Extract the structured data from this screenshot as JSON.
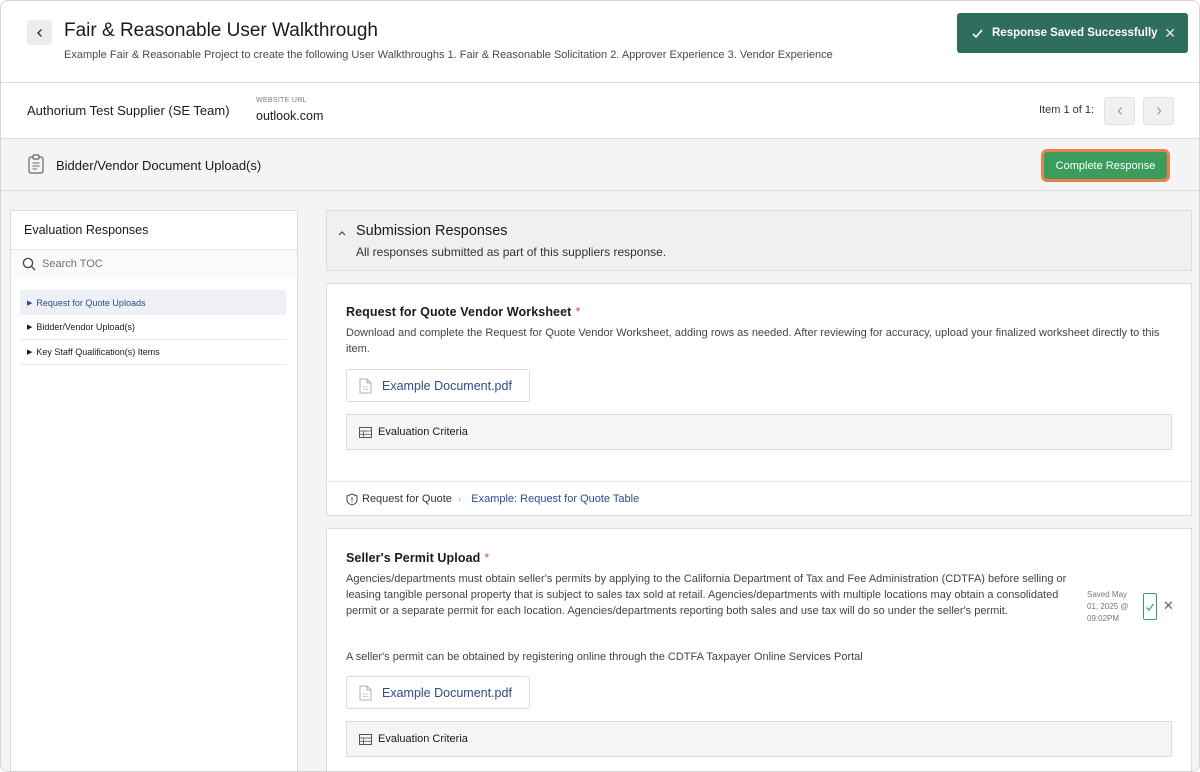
{
  "header": {
    "title": "Fair & Reasonable User Walkthrough",
    "subtitle": "Example Fair & Reasonable Project to create the following User Walkthroughs 1. Fair & Reasonable Solicitation 2. Approver Experience 3. Vendor Experience"
  },
  "toast": {
    "message": "Response Saved Successfully",
    "close_icon": "close-icon"
  },
  "supplier": {
    "name": "Authorium Test Supplier (SE Team)",
    "website_label": "WEBSITE URL",
    "website": "outlook.com",
    "item_count": "Item 1 of 1:"
  },
  "section": {
    "title": "Bidder/Vendor Document Upload(s)",
    "complete_label": "Complete Response"
  },
  "toc": {
    "title": "Evaluation Responses",
    "search_placeholder": "Search TOC",
    "items": [
      {
        "label": "Request for Quote Uploads",
        "active": true
      },
      {
        "label": "Bidder/Vendor Upload(s)",
        "active": false
      },
      {
        "label": "Key Staff Qualification(s) Items",
        "active": false
      }
    ]
  },
  "submission": {
    "title": "Submission Responses",
    "description": "All responses submitted as part of this suppliers response."
  },
  "cards": [
    {
      "title": "Request for Quote Vendor Worksheet",
      "required": "*",
      "description": "Download and complete the Request for Quote Vendor Worksheet, adding rows as needed. After reviewing for accuracy, upload your finalized worksheet directly to this item.",
      "document": "Example Document.pdf",
      "evaluation_label": "Evaluation Criteria",
      "footer_section": "Request for Quote",
      "footer_link": "Example: Request for Quote Table"
    },
    {
      "title": "Seller's Permit Upload",
      "required": "*",
      "description": "Agencies/departments must obtain seller's permits by applying to the California Department of Tax and Fee Administration (CDTFA) before selling or leasing tangible personal property that is subject to sales tax sold at retail.  Agencies/departments with multiple locations may obtain a consolidated permit or a separate permit for each location. Agencies/departments reporting both sales and use tax will do so under the seller's permit.",
      "description2": "A seller's permit can be obtained by registering online through the CDTFA Taxpayer Online Services Portal",
      "document": "Example Document.pdf",
      "evaluation_label": "Evaluation Criteria",
      "saved_info": "Saved May 01, 2025 @ 09:02PM"
    }
  ],
  "colors": {
    "toast_bg": "#2f6e5e",
    "complete_btn": "#3c9c5c",
    "highlight_border": "#e8824f",
    "link": "#2e4d8c",
    "required": "#d94c3c"
  }
}
